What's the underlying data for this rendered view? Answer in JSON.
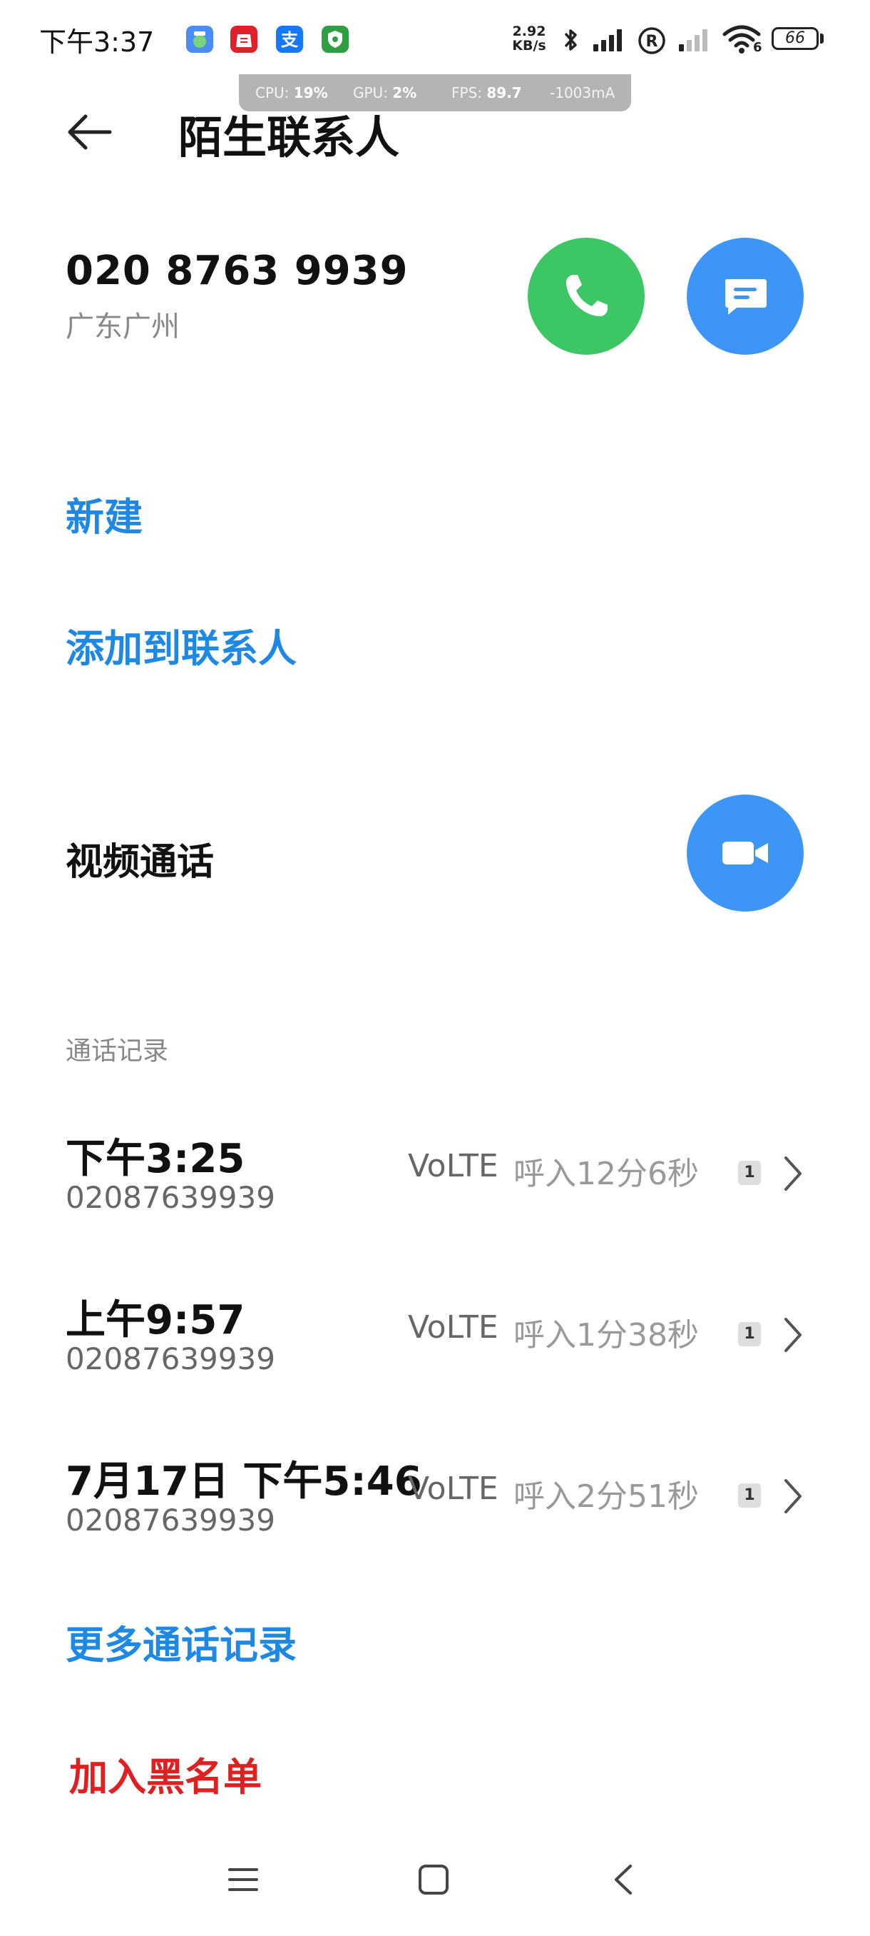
{
  "status_bar": {
    "time": "下午3:37",
    "net_speed_value": "2.92",
    "net_speed_unit": "KB/s",
    "battery": "66",
    "signal_label": "6"
  },
  "perf_overlay": {
    "cpu_label": "CPU:",
    "cpu_value": "19%",
    "gpu_label": "GPU:",
    "gpu_value": "2%",
    "fps_label": "FPS:",
    "fps_value": "89.7",
    "current": "-1003mA"
  },
  "header": {
    "title": "陌生联系人"
  },
  "contact": {
    "number": "020 8763 9939",
    "location": "广东广州"
  },
  "actions": {
    "new": "新建",
    "add_to_contacts": "添加到联系人",
    "video_call": "视频通话",
    "more_call_log": "更多通话记录",
    "block": "加入黑名单"
  },
  "call_log": {
    "header": "通话记录",
    "rows": [
      {
        "time": "下午3:25",
        "number": "02087639939",
        "type": "VoLTE",
        "duration": "呼入12分6秒",
        "sim": "1"
      },
      {
        "time": "上午9:57",
        "number": "02087639939",
        "type": "VoLTE",
        "duration": "呼入1分38秒",
        "sim": "1"
      },
      {
        "time": "7月17日 下午5:46",
        "number": "02087639939",
        "type": "VoLTE",
        "duration": "呼入2分51秒",
        "sim": "1"
      }
    ]
  },
  "colors": {
    "call_green": "#3cc764",
    "action_blue": "#3d96f6",
    "link_blue": "#1e88e5",
    "danger_red": "#e02020"
  },
  "icons": {
    "back": "arrow-left-icon",
    "call": "phone-icon",
    "message": "message-icon",
    "video": "video-camera-icon",
    "chevron": "chevron-right-icon",
    "nav_menu": "menu-icon",
    "nav_home": "home-icon",
    "nav_back": "back-icon"
  }
}
